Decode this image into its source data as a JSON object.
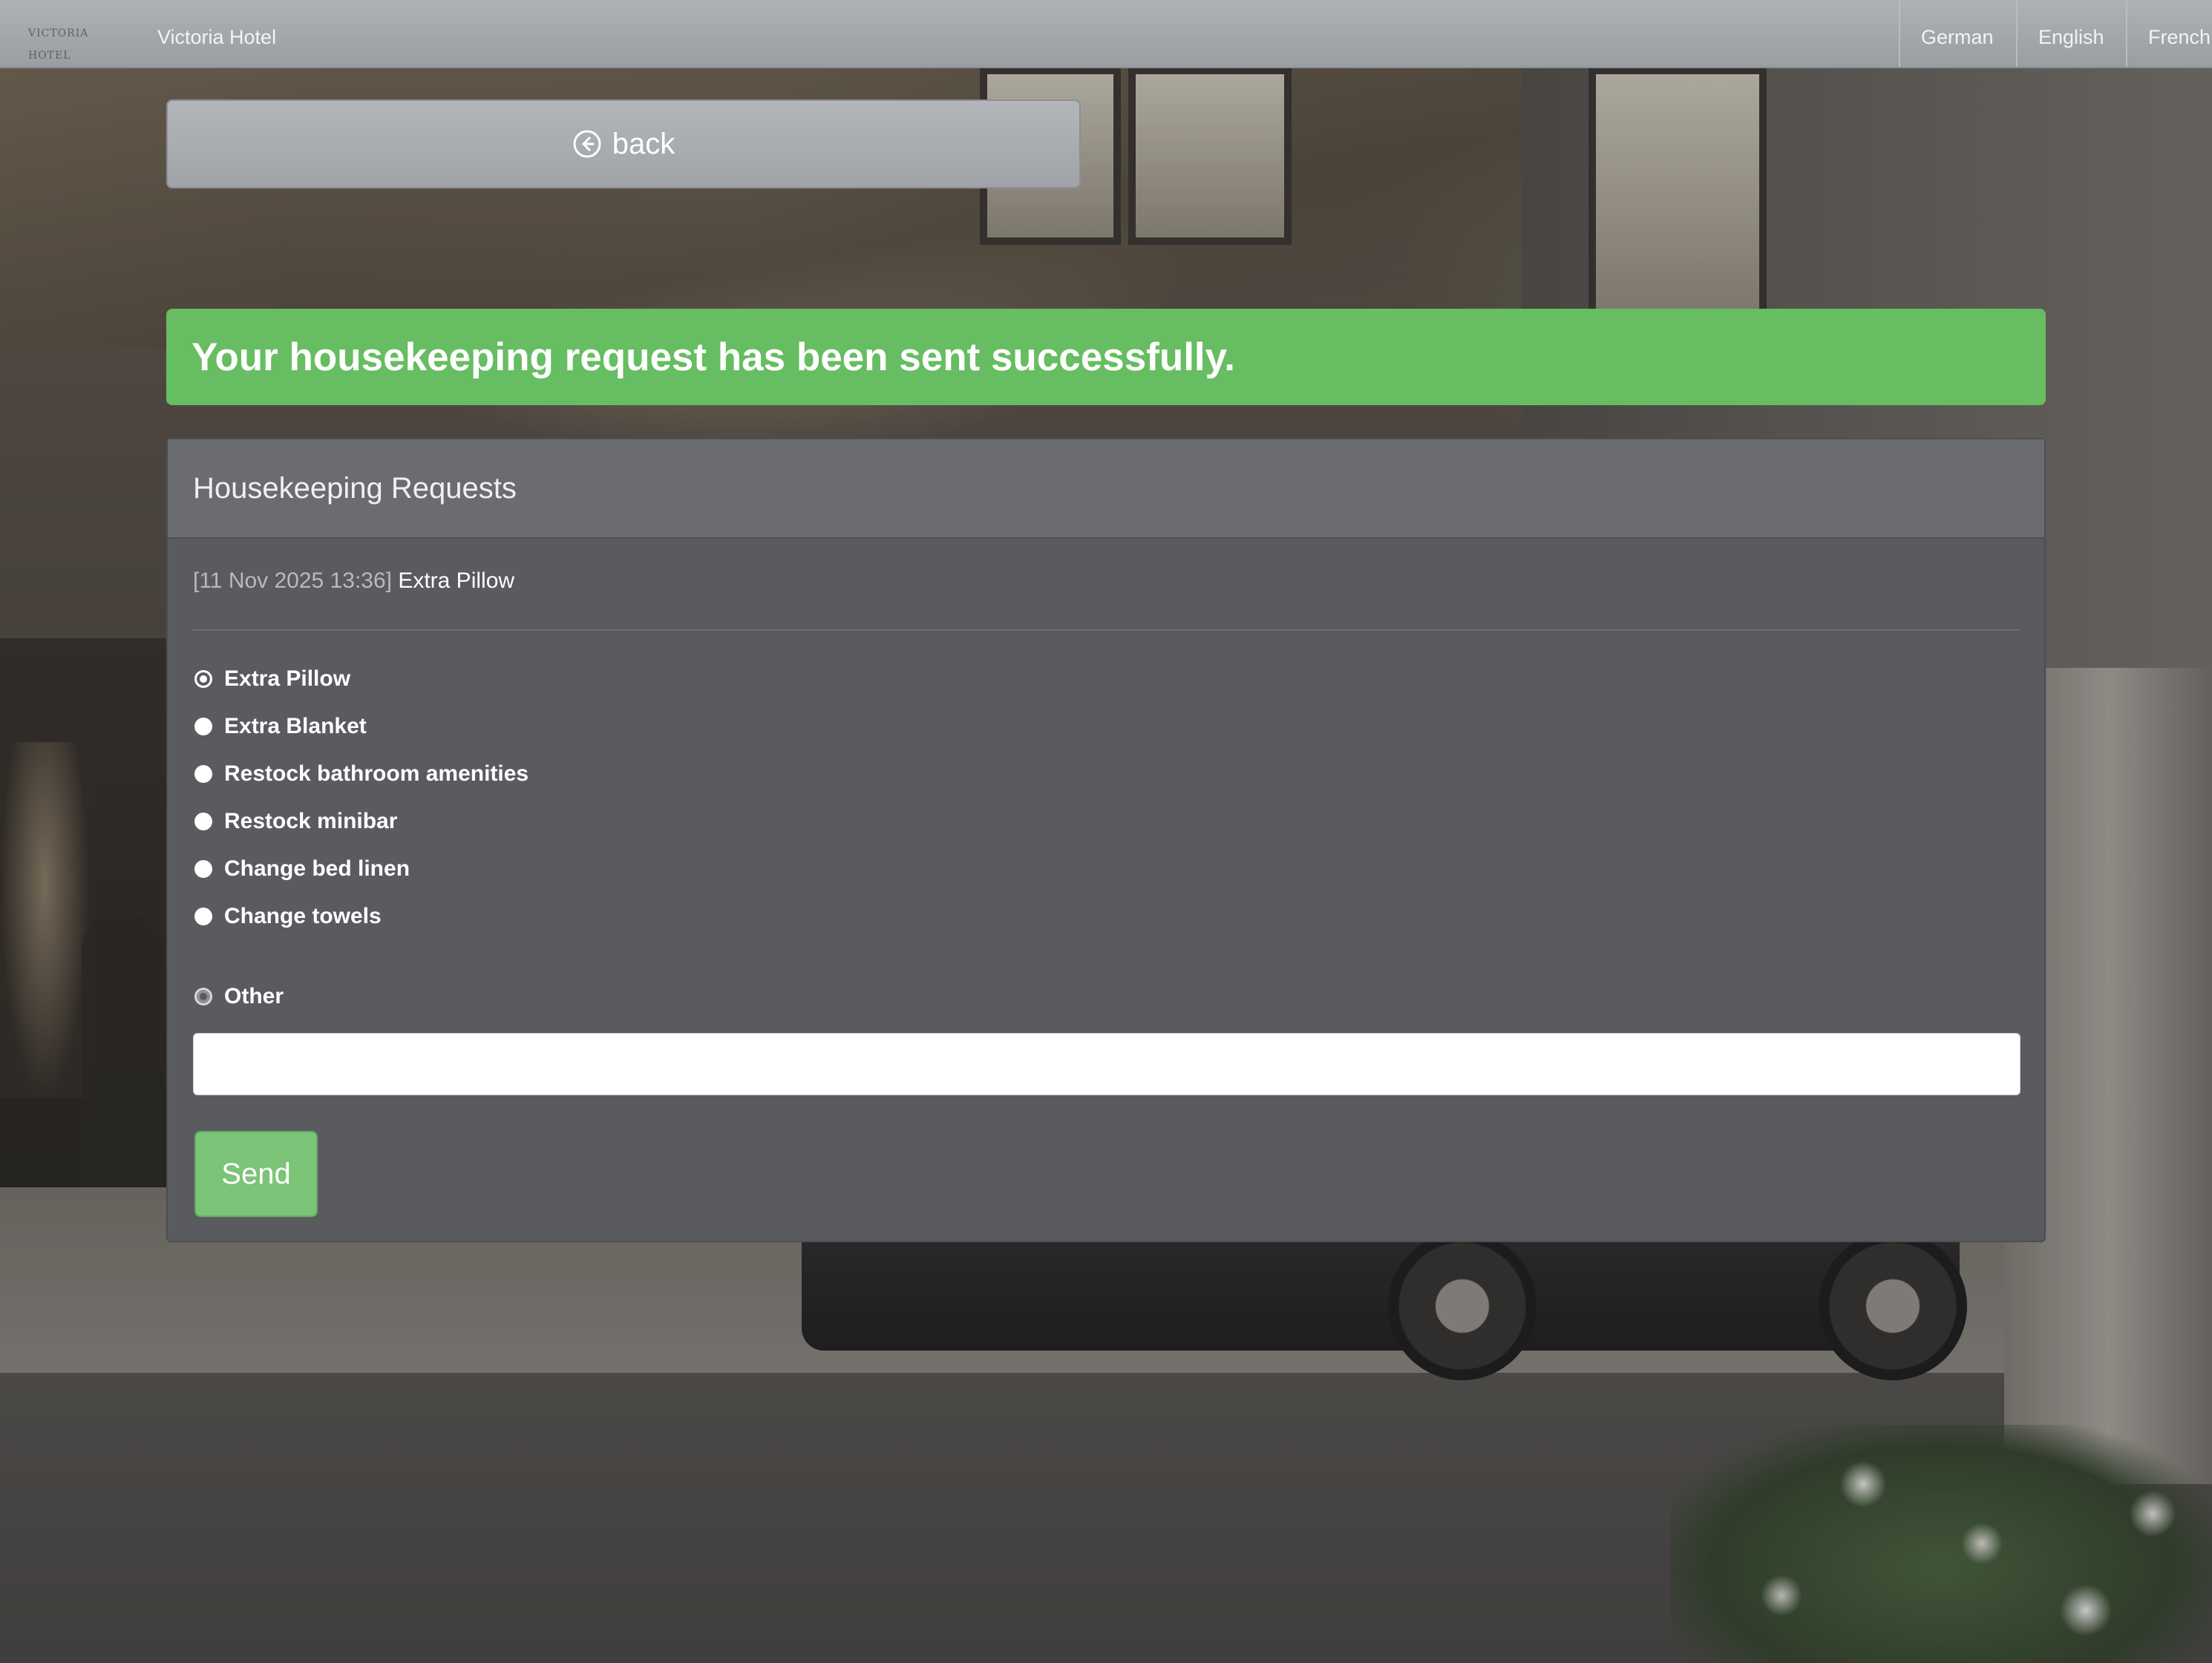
{
  "navbar": {
    "brand_logo_text": "VICTORIA HOTEL",
    "brand_name": "Victoria Hotel",
    "languages": [
      {
        "label": "German"
      },
      {
        "label": "English"
      },
      {
        "label": "French"
      }
    ]
  },
  "back_button": {
    "label": "back",
    "icon": "arrow-left-circle-icon"
  },
  "alert": {
    "message": "Your housekeeping request has been sent successfully.",
    "color": "#67bd62"
  },
  "panel": {
    "title": "Housekeeping Requests",
    "history": [
      {
        "timestamp": "[11 Nov 2025 13:36]",
        "item": "Extra Pillow"
      }
    ],
    "options": [
      {
        "label": "Extra Pillow",
        "selected": true
      },
      {
        "label": "Extra Blanket",
        "selected": false
      },
      {
        "label": "Restock bathroom amenities",
        "selected": false
      },
      {
        "label": "Restock minibar",
        "selected": false
      },
      {
        "label": "Change bed linen",
        "selected": false
      },
      {
        "label": "Change towels",
        "selected": false
      }
    ],
    "other": {
      "label": "Other",
      "value": "",
      "placeholder": ""
    },
    "send_label": "Send"
  },
  "colors": {
    "navbar": "#a4a8ac",
    "panel": "#595b5f",
    "send": "#7cc478"
  }
}
